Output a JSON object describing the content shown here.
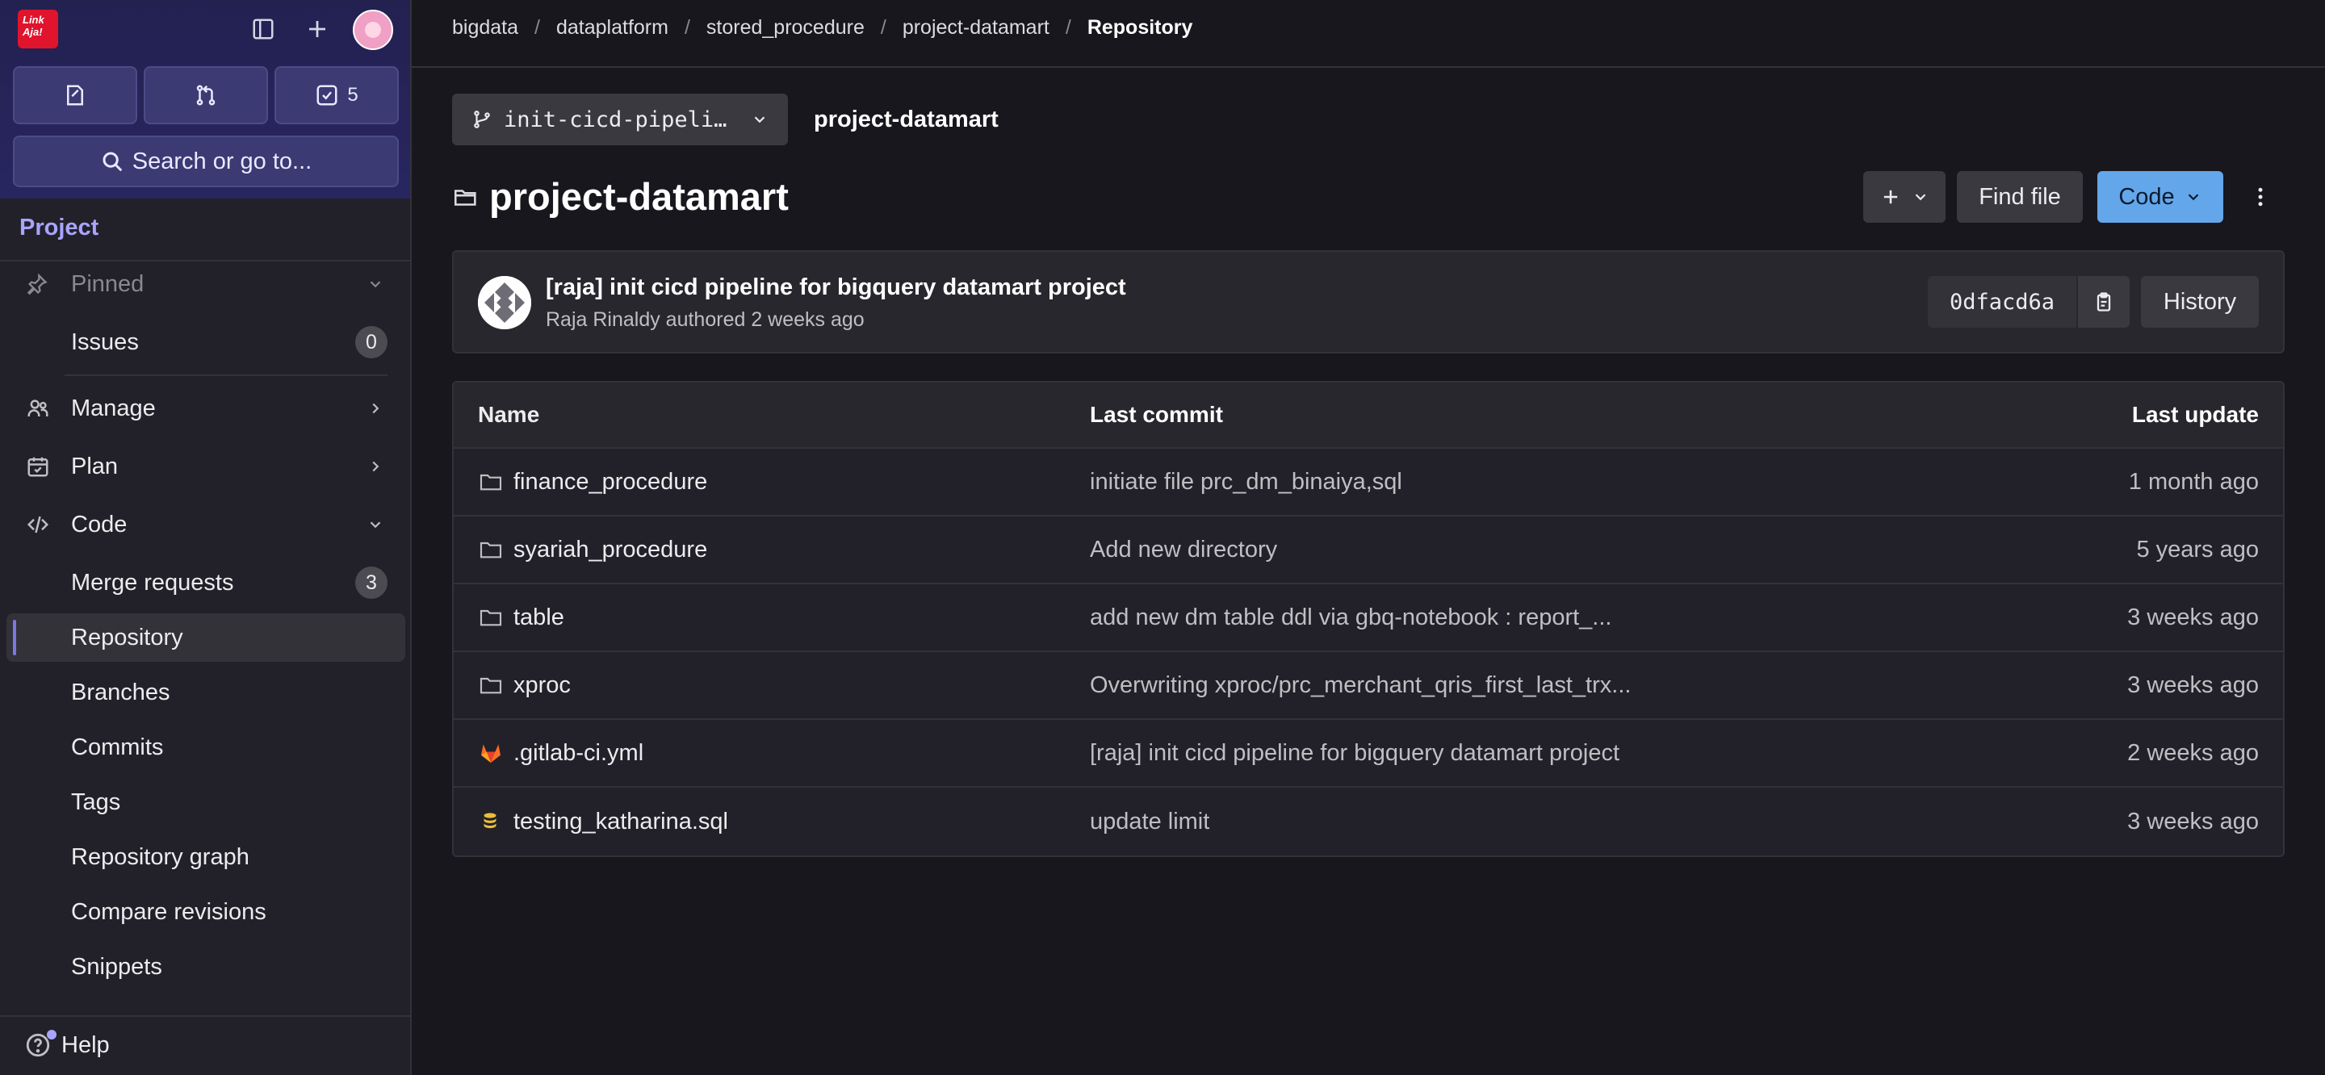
{
  "app": {
    "logo_text": "Link Aja!",
    "issues_count_btn": "",
    "mr_count_btn": "",
    "todo_count": "5",
    "search_placeholder": "Search or go to..."
  },
  "sidebar": {
    "section_title": "Project",
    "pinned_label": "Pinned",
    "issues_label": "Issues",
    "issues_badge": "0",
    "items": [
      {
        "label": "Manage"
      },
      {
        "label": "Plan"
      },
      {
        "label": "Code"
      }
    ],
    "code_sub": [
      {
        "label": "Merge requests",
        "badge": "3"
      },
      {
        "label": "Repository"
      },
      {
        "label": "Branches"
      },
      {
        "label": "Commits"
      },
      {
        "label": "Tags"
      },
      {
        "label": "Repository graph"
      },
      {
        "label": "Compare revisions"
      },
      {
        "label": "Snippets"
      }
    ],
    "help_label": "Help"
  },
  "breadcrumb": [
    "bigdata",
    "dataplatform",
    "stored_procedure",
    "project-datamart",
    "Repository"
  ],
  "repo": {
    "branch": "init-cicd-pipeli…",
    "path_label": "project-datamart",
    "title": "project-datamart",
    "find_file": "Find file",
    "code_btn": "Code"
  },
  "commit": {
    "title": "[raja] init cicd pipeline for bigquery datamart project",
    "meta": "Raja Rinaldy authored 2 weeks ago",
    "sha": "0dfacd6a",
    "history": "History"
  },
  "files": {
    "headers": {
      "name": "Name",
      "last_commit": "Last commit",
      "last_update": "Last update"
    },
    "rows": [
      {
        "icon": "folder-icon",
        "name": "finance_procedure",
        "commit": "initiate file prc_dm_binaiya,sql",
        "updated": "1 month ago"
      },
      {
        "icon": "folder-icon",
        "name": "syariah_procedure",
        "commit": "Add new directory",
        "updated": "5 years ago"
      },
      {
        "icon": "folder-icon",
        "name": "table",
        "commit": "add new dm table ddl via gbq-notebook : report_...",
        "updated": "3 weeks ago"
      },
      {
        "icon": "folder-icon",
        "name": "xproc",
        "commit": "Overwriting xproc/prc_merchant_qris_first_last_trx...",
        "updated": "3 weeks ago"
      },
      {
        "icon": "gitlab-icon",
        "name": ".gitlab-ci.yml",
        "commit": "[raja] init cicd pipeline for bigquery datamart project",
        "updated": "2 weeks ago"
      },
      {
        "icon": "database-icon",
        "name": "testing_katharina.sql",
        "commit": "update limit",
        "updated": "3 weeks ago"
      }
    ]
  },
  "colors": {
    "accent": "#7b78e6",
    "code_button": "#63a6e9",
    "background": "#18171d",
    "sidebar": "#222129"
  }
}
